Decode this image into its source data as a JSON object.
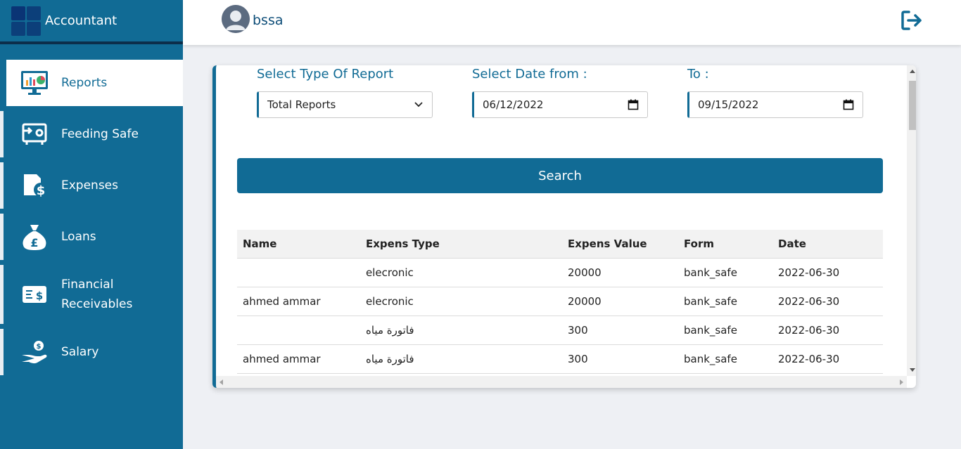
{
  "brand": {
    "title": "Accountant"
  },
  "user": {
    "name": "bssa"
  },
  "nav": [
    {
      "label": "Reports",
      "icon": "reports-monitor-icon",
      "active": true
    },
    {
      "label": "Feeding Safe",
      "icon": "safe-deposit-icon"
    },
    {
      "label": "Expenses",
      "icon": "expenses-document-icon"
    },
    {
      "label": "Loans",
      "icon": "money-bag-icon"
    },
    {
      "label": "Financial Receivables",
      "icon": "cash-receivable-icon"
    },
    {
      "label": "Salary",
      "icon": "salary-hand-icon"
    }
  ],
  "filters": {
    "report_type_label": "Select Type Of Report",
    "report_type_value": "Total Reports",
    "date_from_label": "Select Date from :",
    "date_from_value": "06/12/2022",
    "date_to_label": "To :",
    "date_to_value": "09/15/2022"
  },
  "search_button": "Search",
  "table": {
    "headers": [
      "Name",
      "Expens Type",
      "Expens Value",
      "Form",
      "Date"
    ],
    "rows": [
      [
        "",
        "elecronic",
        "20000",
        "bank_safe",
        "2022-06-30"
      ],
      [
        "ahmed ammar",
        "elecronic",
        "20000",
        "bank_safe",
        "2022-06-30"
      ],
      [
        "",
        "فاتورة مياه",
        "300",
        "bank_safe",
        "2022-06-30"
      ],
      [
        "ahmed ammar",
        "فاتورة مياه",
        "300",
        "bank_safe",
        "2022-06-30"
      ]
    ]
  },
  "colors": {
    "primary": "#116b95",
    "sidebar": "#116b95",
    "background": "#eef0f4"
  }
}
